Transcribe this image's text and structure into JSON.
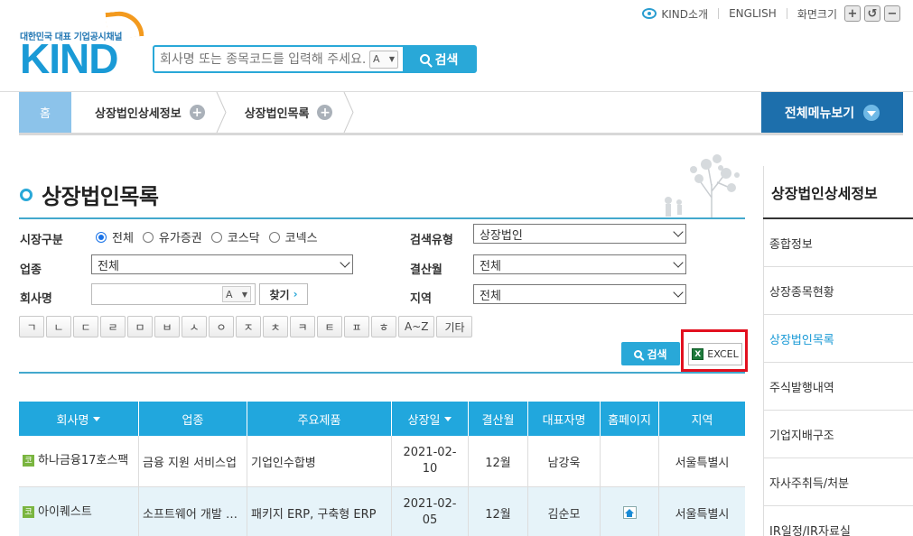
{
  "util": {
    "kind_intro": "KIND소개",
    "english": "ENGLISH",
    "zoom_label": "화면크기",
    "zoom_in": "+",
    "zoom_reset": "↺",
    "zoom_out": "−"
  },
  "logo": {
    "tagline": "대한민국 대표 기업공시채널",
    "word": "KIND"
  },
  "search": {
    "placeholder": "회사명 또는 종목코드를 입력해 주세요.",
    "a_label": "A",
    "button": "검색"
  },
  "nav": {
    "home": "홈",
    "crumb1": "상장법인상세정보",
    "crumb2": "상장법인목록",
    "all_menu": "전체메뉴보기"
  },
  "page_title": "상장법인목록",
  "form": {
    "market_label": "시장구분",
    "market_options": [
      "전체",
      "유가증권",
      "코스닥",
      "코넥스"
    ],
    "market_selected": 0,
    "search_type_label": "검색유형",
    "search_type_value": "상장법인",
    "industry_label": "업종",
    "industry_value": "전체",
    "settle_label": "결산월",
    "settle_value": "전체",
    "company_label": "회사명",
    "company_a": "A",
    "find_button": "찾기",
    "region_label": "지역",
    "region_value": "전체",
    "alphabet": [
      "ㄱ",
      "ㄴ",
      "ㄷ",
      "ㄹ",
      "ㅁ",
      "ㅂ",
      "ㅅ",
      "ㅇ",
      "ㅈ",
      "ㅊ",
      "ㅋ",
      "ㅌ",
      "ㅍ",
      "ㅎ",
      "A~Z",
      "기타"
    ],
    "search_button": "검색",
    "excel_button": "EXCEL"
  },
  "table": {
    "headers": [
      "회사명",
      "업종",
      "주요제품",
      "상장일",
      "결산월",
      "대표자명",
      "홈페이지",
      "지역"
    ],
    "rows": [
      {
        "badge": "코",
        "company": "하나금융17호스팩",
        "industry": "금융 지원 서비스업",
        "product": "기업인수합병",
        "listed_line1": "2021-02-",
        "listed_line2": "10",
        "settle": "12월",
        "ceo": "남강욱",
        "region": "서울특별시"
      },
      {
        "badge": "코",
        "company": "아이퀘스트",
        "industry": "소프트웨어 개발 및 공급업",
        "product": "패키지 ERP, 구축형 ERP",
        "listed_line1": "2021-02-",
        "listed_line2": "05",
        "settle": "12월",
        "ceo": "김순모",
        "region": "서울특별시"
      }
    ]
  },
  "sidebar": {
    "title": "상장법인상세정보",
    "items": [
      "종합정보",
      "상장종목현황",
      "상장법인목록",
      "주식발행내역",
      "기업지배구조",
      "자사주취득/처분",
      "IR일정/IR자료실"
    ],
    "active_index": 2
  },
  "colors": {
    "accent": "#29a8d8",
    "nav_dark": "#1d6fac",
    "highlight": "#e2101f"
  }
}
